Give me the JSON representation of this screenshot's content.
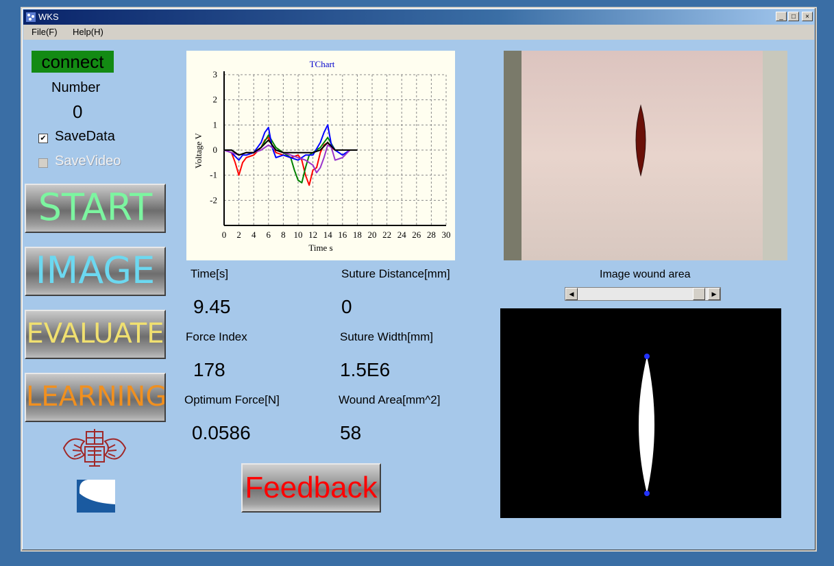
{
  "window": {
    "title": "WKS",
    "min_label": "_",
    "max_label": "□",
    "close_label": "×"
  },
  "menu": [
    {
      "label": "File(F)"
    },
    {
      "label": "Help(H)"
    }
  ],
  "status": {
    "connect_label": "connect",
    "number_label": "Number",
    "number_value": "0"
  },
  "options": {
    "save_data_label": "SaveData",
    "save_data_checked": true,
    "save_video_label": "SaveVideo",
    "save_video_enabled": false
  },
  "buttons": {
    "start": {
      "label": "START",
      "color": "#7cf5a0"
    },
    "image": {
      "label": "IMAGE",
      "color": "#6cd8f0"
    },
    "evaluate": {
      "label": "EVALUATE",
      "color": "#f0e070"
    },
    "learning": {
      "label": "LEARNING",
      "color": "#f09020"
    },
    "feedback": {
      "label": "Feedback",
      "color": "#ff0000"
    }
  },
  "metrics": {
    "time_label": "Time[s]",
    "time_value": "9.45",
    "suture_distance_label": "Suture Distance[mm]",
    "suture_distance_value": "0",
    "force_index_label": "Force Index",
    "force_index_value": "178",
    "suture_width_label": "Suture Width[mm]",
    "suture_width_value": "1.5E6",
    "optimum_force_label": "Optimum Force[N]",
    "optimum_force_value": "0.0586",
    "wound_area_label": "Wound Area[mm^2]",
    "wound_area_value": "58"
  },
  "image_panel": {
    "label": "Image wound area",
    "slider_position": 0.9
  },
  "chart_data": {
    "type": "line",
    "title": "TChart",
    "xlabel": "Time s",
    "ylabel": "Voltage V",
    "xlim": [
      0,
      30
    ],
    "ylim": [
      -3,
      3
    ],
    "xticks": [
      "0",
      "2",
      "4",
      "6",
      "8",
      "10",
      "12",
      "14",
      "16",
      "18",
      "20",
      "22",
      "24",
      "26",
      "28",
      "30"
    ],
    "yticks": [
      "3",
      "2",
      "1",
      "0",
      "-1",
      "-2"
    ],
    "grid": true,
    "series": [
      {
        "color": "#ff0000",
        "x": [
          0,
          1,
          1.5,
          2,
          2.5,
          3,
          4,
          5,
          5.5,
          6,
          6.5,
          7,
          8,
          9,
          10,
          10.5,
          11,
          11.5,
          12,
          12.5,
          13,
          13.5,
          14,
          14.5,
          15,
          16,
          17,
          18
        ],
        "y": [
          0,
          -0.1,
          -0.5,
          -1.0,
          -0.5,
          -0.3,
          -0.2,
          0.1,
          0.4,
          0.5,
          0.2,
          -0.1,
          -0.2,
          -0.3,
          -0.2,
          -0.4,
          -1.0,
          -1.4,
          -0.8,
          -0.7,
          -0.1,
          0.2,
          0.3,
          0.1,
          0.0,
          0.0,
          0.0,
          0.0
        ]
      },
      {
        "color": "#008000",
        "x": [
          0,
          1,
          2,
          3,
          4,
          5,
          6,
          7,
          8,
          9,
          9.5,
          10,
          10.5,
          11,
          11.5,
          12,
          13,
          14,
          15,
          16,
          17,
          18
        ],
        "y": [
          0,
          0,
          -0.2,
          -0.1,
          -0.1,
          0.1,
          0.6,
          0.1,
          -0.1,
          -0.3,
          -0.8,
          -1.2,
          -1.3,
          -0.7,
          -0.2,
          -0.1,
          0.1,
          0.5,
          0.0,
          0.0,
          0.0,
          0.0
        ]
      },
      {
        "color": "#0000ff",
        "x": [
          0,
          1,
          2,
          2.5,
          3,
          4,
          5,
          5.5,
          6,
          6.5,
          7,
          8,
          9,
          10,
          11,
          12,
          13,
          13.5,
          14,
          14.5,
          15,
          16,
          17,
          18
        ],
        "y": [
          0,
          -0.1,
          -0.4,
          -0.2,
          -0.2,
          -0.1,
          0.3,
          0.7,
          0.9,
          0.1,
          -0.3,
          -0.2,
          -0.3,
          -0.4,
          -0.2,
          -0.2,
          0.3,
          0.7,
          1.0,
          0.2,
          0.0,
          -0.2,
          0.0,
          0.0
        ]
      },
      {
        "color": "#9933cc",
        "x": [
          0,
          1,
          2,
          3,
          4,
          5,
          6,
          7,
          8,
          9,
          10,
          11,
          12,
          12.5,
          13,
          13.5,
          14,
          14.5,
          15,
          16,
          17,
          18
        ],
        "y": [
          0,
          -0.1,
          -0.2,
          -0.1,
          -0.1,
          0.0,
          0.2,
          0.0,
          -0.1,
          -0.2,
          -0.3,
          -0.4,
          -0.6,
          -0.9,
          -0.7,
          -0.3,
          0.2,
          0.1,
          -0.4,
          -0.3,
          0.0,
          0.0
        ]
      },
      {
        "color": "#000000",
        "x": [
          0,
          1,
          2,
          3,
          4,
          5,
          6,
          7,
          8,
          9,
          10,
          11,
          12,
          13,
          14,
          15,
          16,
          17,
          18
        ],
        "y": [
          0,
          0,
          -0.2,
          -0.1,
          -0.1,
          0.1,
          0.4,
          0.0,
          -0.1,
          -0.1,
          -0.1,
          -0.1,
          -0.1,
          0.0,
          0.3,
          0.0,
          0.0,
          0.0,
          0.0
        ]
      }
    ]
  }
}
